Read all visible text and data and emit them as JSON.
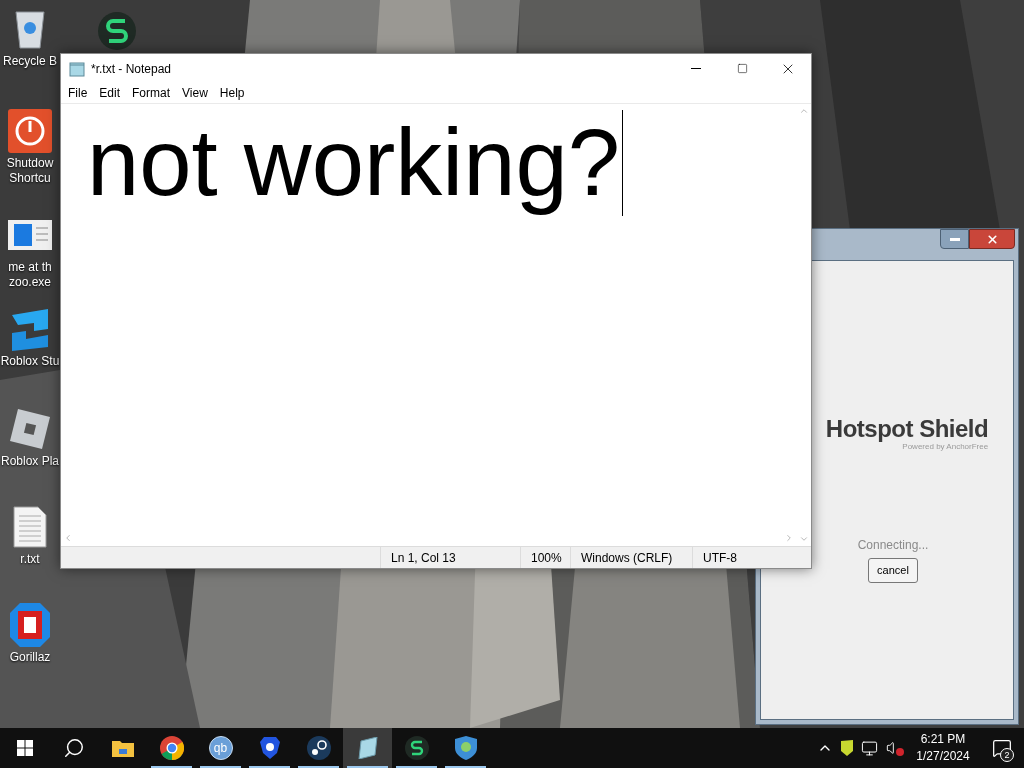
{
  "desktop": {
    "icons": [
      {
        "kind": "recycle-bin",
        "label_lines": [
          "Recycle B"
        ]
      },
      {
        "kind": "shutdown",
        "label_lines": [
          "Shutdow",
          "Shortcu"
        ]
      },
      {
        "kind": "document-window",
        "label_lines": [
          "me at th",
          "zoo.exe"
        ]
      },
      {
        "kind": "roblox-studio",
        "label_lines": [
          "Roblox Stu"
        ]
      },
      {
        "kind": "roblox-player",
        "label_lines": [
          "Roblox Pla"
        ]
      },
      {
        "kind": "text-file",
        "label_lines": [
          "r.txt"
        ]
      },
      {
        "kind": "gorillaz",
        "label_lines": [
          "Gorillaz"
        ]
      },
      {
        "kind": "green-app"
      }
    ]
  },
  "notepad": {
    "title": "*r.txt - Notepad",
    "menu": [
      "File",
      "Edit",
      "Format",
      "View",
      "Help"
    ],
    "text": "not working?",
    "status_bar": [
      "Ln 1, Col 13",
      "100%",
      "Windows (CRLF)",
      "UTF-8"
    ]
  },
  "hotspot_shield": {
    "brand": "Hotspot Shield",
    "tagline": "Powered by AnchorFree",
    "status": "Connecting...",
    "button": "cancel"
  },
  "taskbar": {
    "items": [
      {
        "kind": "start",
        "running": false,
        "active": false
      },
      {
        "kind": "search",
        "running": false,
        "active": false
      },
      {
        "kind": "folder",
        "running": false,
        "active": false
      },
      {
        "kind": "chrome",
        "running": true,
        "active": false
      },
      {
        "kind": "qbittorrent",
        "text": "qb",
        "running": true,
        "active": false
      },
      {
        "kind": "brave",
        "running": true,
        "active": false
      },
      {
        "kind": "steam",
        "running": true,
        "active": false
      },
      {
        "kind": "notepad",
        "running": true,
        "active": true
      },
      {
        "kind": "green-app",
        "running": true,
        "active": false
      },
      {
        "kind": "shield",
        "running": true,
        "active": false
      }
    ],
    "tray": {
      "volume_muted": true,
      "time": "6:21 PM",
      "date": "1/27/2024",
      "notification_count": "2"
    }
  }
}
